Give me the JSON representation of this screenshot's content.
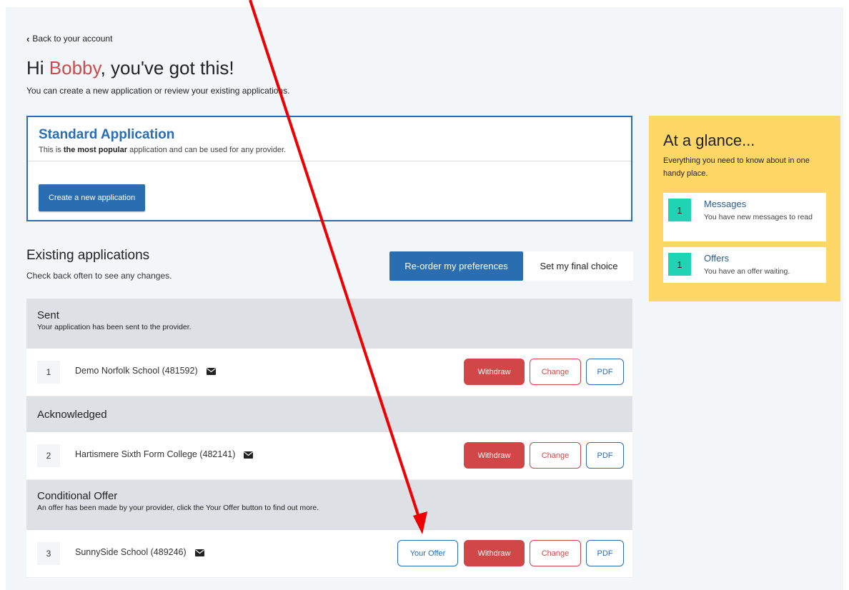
{
  "nav": {
    "back_label": "Back to your account"
  },
  "header": {
    "greeting_prefix": "Hi ",
    "user_name": "Bobby",
    "greeting_suffix": ", you've got this!",
    "intro": "You can create a new application or review your existing applications."
  },
  "standard": {
    "title": "Standard Application",
    "desc_prefix": "This is ",
    "desc_bold": "the most popular",
    "desc_suffix": " application and can be used for any provider.",
    "create_label": "Create a new application"
  },
  "existing": {
    "title": "Existing applications",
    "subtitle": "Check back often to see any changes.",
    "reorder_label": "Re-order my preferences",
    "final_label": "Set my final choice"
  },
  "groups": [
    {
      "title": "Sent",
      "desc": "Your application has been sent to the provider.",
      "rows": [
        {
          "num": "1",
          "name": "Demo Norfolk School (481592)"
        }
      ]
    },
    {
      "title": "Acknowledged",
      "rows": [
        {
          "num": "2",
          "name": "Hartismere Sixth Form College (482141)"
        }
      ]
    },
    {
      "title": "Conditional Offer",
      "desc": "An offer has been made by your provider, click the Your Offer button to find out more.",
      "rows": [
        {
          "num": "3",
          "name": "SunnySide School (489246)"
        }
      ]
    }
  ],
  "row_buttons": {
    "offer": "Your Offer",
    "withdraw": "Withdraw",
    "change": "Change",
    "pdf": "PDF"
  },
  "glance": {
    "title": "At a glance...",
    "desc": "Everything you need to know about in one handy place.",
    "messages": {
      "count": "1",
      "title": "Messages",
      "text": "You have new messages to read"
    },
    "offers": {
      "count": "1",
      "title": "Offers",
      "text": "You have an offer waiting."
    }
  },
  "colors": {
    "primary": "#2a6db0",
    "danger": "#d14646",
    "accent_name": "#cc4a4a",
    "glance_bg": "#fed767",
    "badge": "#20d3b3",
    "annotation_arrow": "#ee0000"
  },
  "icons": {
    "back": "chevron-left-icon",
    "mail": "envelope-icon"
  }
}
